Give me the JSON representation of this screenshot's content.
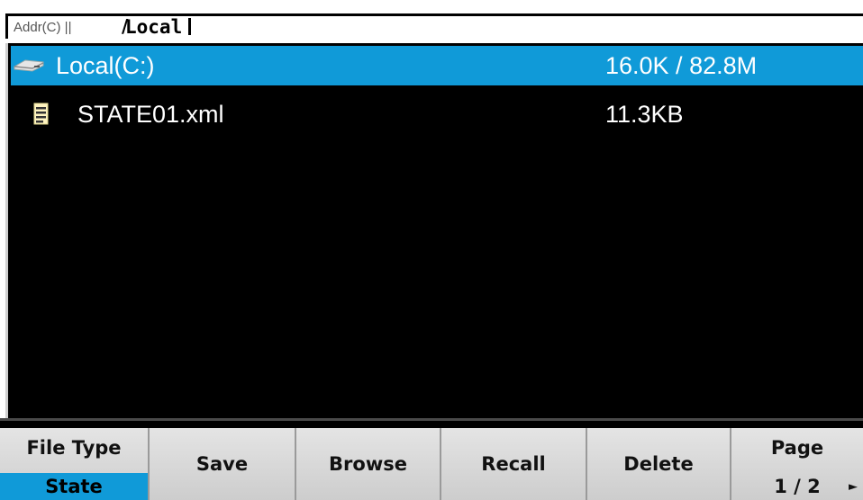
{
  "address_bar": {
    "label": "Addr(C) ||",
    "separator": "/",
    "path": "Local"
  },
  "file_list": {
    "items": [
      {
        "name": "Local(C:)",
        "size": "16.0K / 82.8M",
        "icon": "drive-icon",
        "selected": true
      },
      {
        "name": "STATE01.xml",
        "size": "11.3KB",
        "icon": "document-icon",
        "selected": false
      }
    ]
  },
  "softkeys": {
    "file_type": {
      "label": "File Type",
      "value": "State"
    },
    "save": {
      "label": "Save"
    },
    "browse": {
      "label": "Browse"
    },
    "recall": {
      "label": "Recall"
    },
    "delete": {
      "label": "Delete"
    },
    "page": {
      "label": "Page",
      "value": "1 / 2",
      "arrow": "►"
    }
  },
  "colors": {
    "selection": "#109ad8",
    "panel_background": "#000000",
    "softkey_background": "#dcdcdc"
  }
}
